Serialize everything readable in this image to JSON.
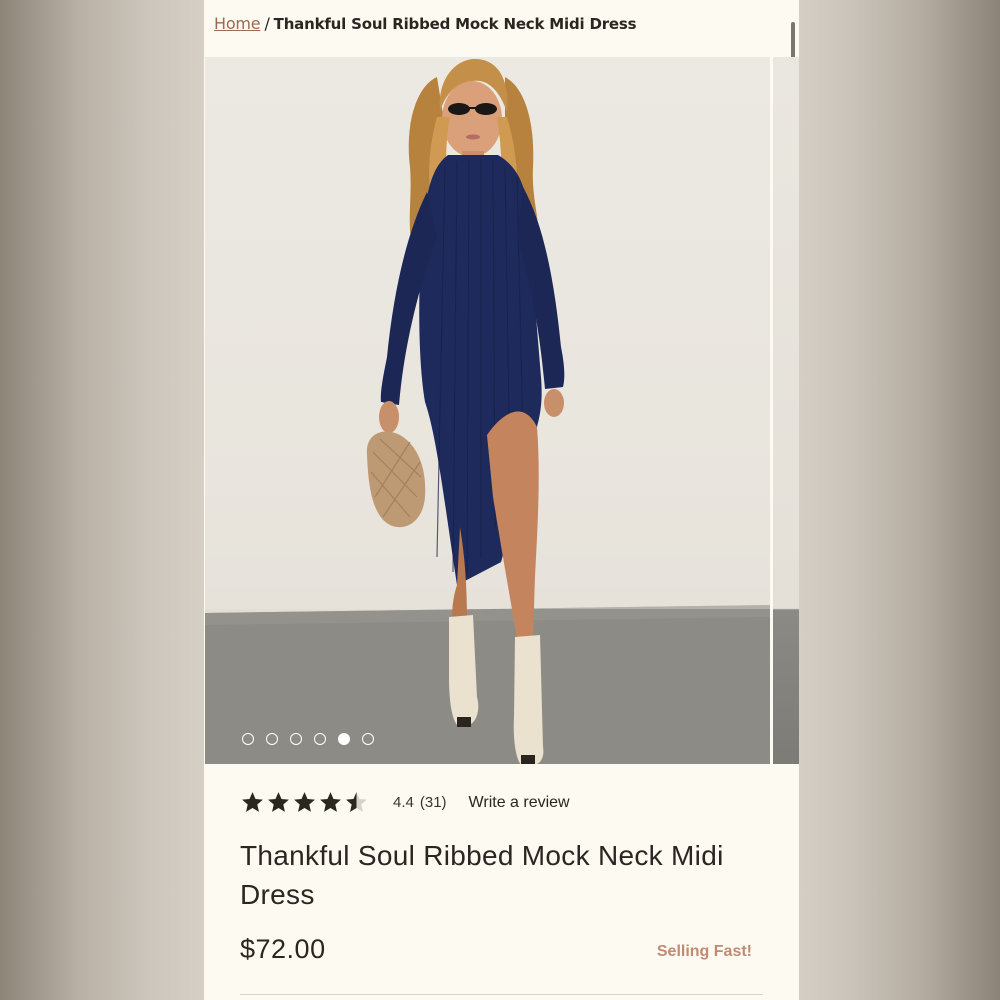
{
  "breadcrumb": {
    "home": "Home",
    "separator": "/",
    "current": "Thankful Soul Ribbed Mock Neck Midi Dress"
  },
  "gallery": {
    "slide_count": 6,
    "active_slide": 5
  },
  "product": {
    "rating_stars": 4.4,
    "rating_value": "4.4",
    "review_count": "(31)",
    "write_review": "Write a review",
    "title": "Thankful Soul Ribbed Mock Neck Midi Dress",
    "price": "$72.00",
    "badge": "Selling Fast!"
  },
  "colors": {
    "page_bg": "#fdfbf1",
    "link": "#9b6a52",
    "text": "#2b2620",
    "badge": "#c28a72",
    "star": "#2b2620",
    "dress": "#1f2a5c"
  },
  "icons": {
    "star": "star-icon",
    "half_star": "star-half-icon",
    "dot": "carousel-dot"
  }
}
